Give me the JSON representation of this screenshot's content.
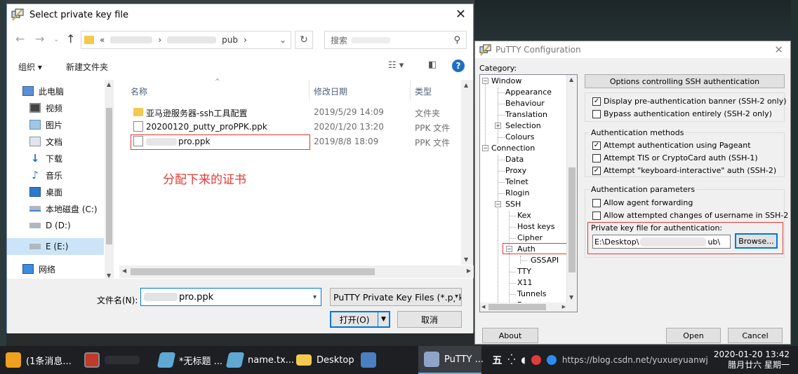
{
  "file_dialog": {
    "title": "Select private key file",
    "address": {
      "prefix": "«",
      "folder_tail": "pub",
      "sep": "›"
    },
    "search_placeholder": "搜索",
    "toolbar": {
      "organize": "组织 ▾",
      "new_folder": "新建文件夹"
    },
    "sidebar": [
      {
        "label": "此电脑",
        "icon": "computer-icon"
      },
      {
        "label": "视频",
        "icon": "video-folder-icon"
      },
      {
        "label": "图片",
        "icon": "pictures-folder-icon"
      },
      {
        "label": "文档",
        "icon": "documents-folder-icon"
      },
      {
        "label": "下载",
        "icon": "download-icon"
      },
      {
        "label": "音乐",
        "icon": "music-icon"
      },
      {
        "label": "桌面",
        "icon": "desktop-icon"
      },
      {
        "label": "本地磁盘 (C:)",
        "icon": "drive-icon"
      },
      {
        "label": "D (D:)",
        "icon": "drive-icon"
      },
      {
        "label": "E (E:)",
        "icon": "drive-icon"
      },
      {
        "label": "网络",
        "icon": "network-icon"
      }
    ],
    "columns": {
      "name": "名称",
      "date": "修改日期",
      "type": "类型"
    },
    "files": [
      {
        "name": "亚马逊服务器-ssh工具配置",
        "date": "2019/5/29 14:09",
        "type": "文件夹",
        "icon": "folder-icon"
      },
      {
        "name": "20200120_putty_proPPK.ppk",
        "date": "2020/1/20 13:20",
        "type": "PPK 文件",
        "icon": "file-icon"
      },
      {
        "name": "pro.ppk",
        "date": "2019/8/8 18:09",
        "type": "PPK 文件",
        "icon": "file-icon"
      }
    ],
    "annotation": "分配下来的证书",
    "filename_label": "文件名(N):",
    "filename_value": "pro.ppk",
    "filetype": "PuTTY Private Key Files (*.ppk)",
    "open_label": "打开(O)",
    "cancel_label": "取消",
    "accent": "#0078d7"
  },
  "putty": {
    "title": "PuTTY Configuration",
    "category_label": "Category:",
    "tree": [
      {
        "label": "Window",
        "level": 0
      },
      {
        "label": "Appearance",
        "level": 1
      },
      {
        "label": "Behaviour",
        "level": 1
      },
      {
        "label": "Translation",
        "level": 1
      },
      {
        "label": "Selection",
        "level": 1
      },
      {
        "label": "Colours",
        "level": 1
      },
      {
        "label": "Connection",
        "level": 0
      },
      {
        "label": "Data",
        "level": 1
      },
      {
        "label": "Proxy",
        "level": 1
      },
      {
        "label": "Telnet",
        "level": 1
      },
      {
        "label": "Rlogin",
        "level": 1
      },
      {
        "label": "SSH",
        "level": 1
      },
      {
        "label": "Kex",
        "level": 2
      },
      {
        "label": "Host keys",
        "level": 2
      },
      {
        "label": "Cipher",
        "level": 2
      },
      {
        "label": "Auth",
        "level": 2
      },
      {
        "label": "GSSAPI",
        "level": 3
      },
      {
        "label": "TTY",
        "level": 2
      },
      {
        "label": "X11",
        "level": 2
      },
      {
        "label": "Tunnels",
        "level": 2
      },
      {
        "label": "Bugs",
        "level": 2
      }
    ],
    "panel_header": "Options controlling SSH authentication",
    "banner_options": [
      {
        "label": "Display pre-authentication banner (SSH-2 only)",
        "checked": true
      },
      {
        "label": "Bypass authentication entirely (SSH-2 only)",
        "checked": false
      }
    ],
    "methods_title": "Authentication methods",
    "methods": [
      {
        "label": "Attempt authentication using Pageant",
        "checked": true
      },
      {
        "label": "Attempt TIS or CryptoCard auth (SSH-1)",
        "checked": false
      },
      {
        "label": "Attempt \"keyboard-interactive\" auth (SSH-2)",
        "checked": true
      }
    ],
    "params_title": "Authentication parameters",
    "params": [
      {
        "label": "Allow agent forwarding",
        "checked": false
      },
      {
        "label": "Allow attempted changes of username in SSH-2",
        "checked": false
      }
    ],
    "keyfile_label": "Private key file for authentication:",
    "keyfile_prefix": "E:\\Desktop\\",
    "keyfile_suffix": "ub\\",
    "browse_label": "Browse...",
    "about_label": "About",
    "open_label": "Open",
    "cancel_label": "Cancel"
  },
  "taskbar": {
    "items": [
      {
        "label": "(1条消息...",
        "icon": "chat-app-icon",
        "color": "#f0a020"
      },
      {
        "label": "",
        "icon": "app-icon",
        "color": "#c0392b"
      },
      {
        "label": "*无标题 ...",
        "icon": "notepad-icon",
        "color": "#5fa8d3"
      },
      {
        "label": "name.tx...",
        "icon": "notepad-icon",
        "color": "#5fa8d3"
      },
      {
        "label": "Desktop",
        "icon": "folder-icon",
        "color": "#f4c94e"
      },
      {
        "label": "",
        "icon": "network-app-icon",
        "color": "#4a7fc1"
      },
      {
        "label": "PuTTY ...",
        "icon": "putty-icon",
        "color": "#8fa4c8"
      }
    ],
    "ime": "五",
    "watermark": "https://blog.csdn.net/yuxueyuanwj",
    "clock_time": "2020-01-20 13:42",
    "clock_date": "腊月廿六 星期一"
  }
}
